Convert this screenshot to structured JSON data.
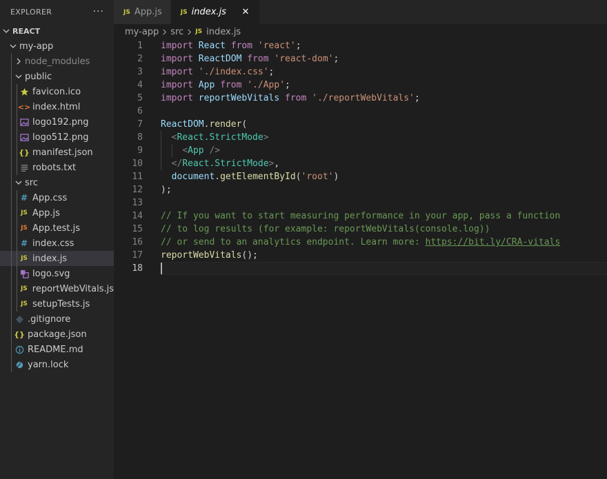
{
  "explorer": {
    "title": "EXPLORER",
    "more": "···",
    "section": "REACT",
    "items": [
      {
        "label": "my-app",
        "depth": 1,
        "kind": "folder-open"
      },
      {
        "label": "node_modules",
        "depth": 2,
        "kind": "folder-closed",
        "dim": true
      },
      {
        "label": "public",
        "depth": 2,
        "kind": "folder-open"
      },
      {
        "label": "favicon.ico",
        "depth": 3,
        "kind": "star"
      },
      {
        "label": "index.html",
        "depth": 3,
        "kind": "html"
      },
      {
        "label": "logo192.png",
        "depth": 3,
        "kind": "image"
      },
      {
        "label": "logo512.png",
        "depth": 3,
        "kind": "image"
      },
      {
        "label": "manifest.json",
        "depth": 3,
        "kind": "json"
      },
      {
        "label": "robots.txt",
        "depth": 3,
        "kind": "text"
      },
      {
        "label": "src",
        "depth": 2,
        "kind": "folder-open"
      },
      {
        "label": "App.css",
        "depth": 3,
        "kind": "css"
      },
      {
        "label": "App.js",
        "depth": 3,
        "kind": "js"
      },
      {
        "label": "App.test.js",
        "depth": 3,
        "kind": "test"
      },
      {
        "label": "index.css",
        "depth": 3,
        "kind": "css"
      },
      {
        "label": "index.js",
        "depth": 3,
        "kind": "js",
        "selected": true
      },
      {
        "label": "logo.svg",
        "depth": 3,
        "kind": "svg"
      },
      {
        "label": "reportWebVitals.js",
        "depth": 3,
        "kind": "js"
      },
      {
        "label": "setupTests.js",
        "depth": 3,
        "kind": "js"
      },
      {
        "label": ".gitignore",
        "depth": 2,
        "kind": "git"
      },
      {
        "label": "package.json",
        "depth": 2,
        "kind": "json"
      },
      {
        "label": "README.md",
        "depth": 2,
        "kind": "info"
      },
      {
        "label": "yarn.lock",
        "depth": 2,
        "kind": "yarn"
      }
    ]
  },
  "tabs": [
    {
      "icon": "JS",
      "label": "App.js",
      "active": false
    },
    {
      "icon": "JS",
      "label": "index.js",
      "active": true,
      "close": "✕"
    }
  ],
  "breadcrumb": {
    "parts": [
      "my-app",
      "src"
    ],
    "file_icon": "JS",
    "file": "index.js"
  },
  "editor": {
    "current_line": 18,
    "lines": [
      [
        [
          "k",
          "import"
        ],
        [
          "p",
          " "
        ],
        [
          "v",
          "React"
        ],
        [
          "p",
          " "
        ],
        [
          "k",
          "from"
        ],
        [
          "p",
          " "
        ],
        [
          "s",
          "'react'"
        ],
        [
          "p",
          ";"
        ]
      ],
      [
        [
          "k",
          "import"
        ],
        [
          "p",
          " "
        ],
        [
          "v",
          "ReactDOM"
        ],
        [
          "p",
          " "
        ],
        [
          "k",
          "from"
        ],
        [
          "p",
          " "
        ],
        [
          "s",
          "'react-dom'"
        ],
        [
          "p",
          ";"
        ]
      ],
      [
        [
          "k",
          "import"
        ],
        [
          "p",
          " "
        ],
        [
          "s",
          "'./index.css'"
        ],
        [
          "p",
          ";"
        ]
      ],
      [
        [
          "k",
          "import"
        ],
        [
          "p",
          " "
        ],
        [
          "v",
          "App"
        ],
        [
          "p",
          " "
        ],
        [
          "k",
          "from"
        ],
        [
          "p",
          " "
        ],
        [
          "s",
          "'./App'"
        ],
        [
          "p",
          ";"
        ]
      ],
      [
        [
          "k",
          "import"
        ],
        [
          "p",
          " "
        ],
        [
          "v",
          "reportWebVitals"
        ],
        [
          "p",
          " "
        ],
        [
          "k",
          "from"
        ],
        [
          "p",
          " "
        ],
        [
          "s",
          "'./reportWebVitals'"
        ],
        [
          "p",
          ";"
        ]
      ],
      [],
      [
        [
          "v",
          "ReactDOM"
        ],
        [
          "p",
          "."
        ],
        [
          "f",
          "render"
        ],
        [
          "p",
          "("
        ]
      ],
      [
        [
          "p",
          "  "
        ],
        [
          "tb",
          "<"
        ],
        [
          "t",
          "React.StrictMode"
        ],
        [
          "tb",
          ">"
        ]
      ],
      [
        [
          "p",
          "    "
        ],
        [
          "tb",
          "<"
        ],
        [
          "t",
          "App"
        ],
        [
          "p",
          " "
        ],
        [
          "tb",
          "/>"
        ]
      ],
      [
        [
          "p",
          "  "
        ],
        [
          "tb",
          "</"
        ],
        [
          "t",
          "React.StrictMode"
        ],
        [
          "tb",
          ">"
        ],
        [
          "p",
          ","
        ]
      ],
      [
        [
          "p",
          "  "
        ],
        [
          "v",
          "document"
        ],
        [
          "p",
          "."
        ],
        [
          "f",
          "getElementById"
        ],
        [
          "p",
          "("
        ],
        [
          "s",
          "'root'"
        ],
        [
          "p",
          ")"
        ]
      ],
      [
        [
          "p",
          ");"
        ]
      ],
      [],
      [
        [
          "c",
          "// If you want to start measuring performance in your app, pass a function"
        ]
      ],
      [
        [
          "c",
          "// to log results (for example: reportWebVitals(console.log))"
        ]
      ],
      [
        [
          "c",
          "// or send to an analytics endpoint. Learn more: "
        ],
        [
          "cu",
          "https://bit.ly/CRA-vitals"
        ]
      ],
      [
        [
          "f",
          "reportWebVitals"
        ],
        [
          "p",
          "();"
        ]
      ],
      []
    ]
  }
}
